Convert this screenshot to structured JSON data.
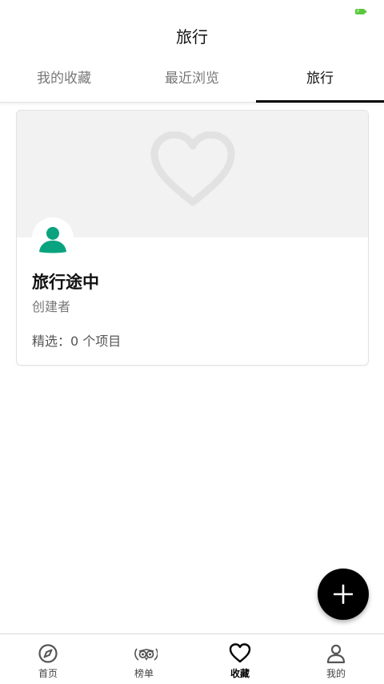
{
  "header": {
    "title": "旅行"
  },
  "tabs": [
    {
      "label": "我的收藏",
      "active": false
    },
    {
      "label": "最近浏览",
      "active": false
    },
    {
      "label": "旅行",
      "active": true
    }
  ],
  "trip_card": {
    "title": "旅行途中",
    "creator": "创建者",
    "meta": "精选：0 个项目",
    "cover_icon": "heart-icon",
    "avatar_icon": "person-icon"
  },
  "fab": {
    "icon": "plus-icon"
  },
  "bottom_nav": [
    {
      "label": "首页",
      "icon": "compass-icon",
      "active": false
    },
    {
      "label": "榜单",
      "icon": "owl-laurel-icon",
      "active": false
    },
    {
      "label": "收藏",
      "icon": "heart-icon",
      "active": true
    },
    {
      "label": "我的",
      "icon": "person-icon",
      "active": false
    }
  ],
  "colors": {
    "accent": "#000000",
    "avatar_green": "#0aa37f",
    "battery": "#5ac83b",
    "cover_bg": "#f2f2f2"
  }
}
